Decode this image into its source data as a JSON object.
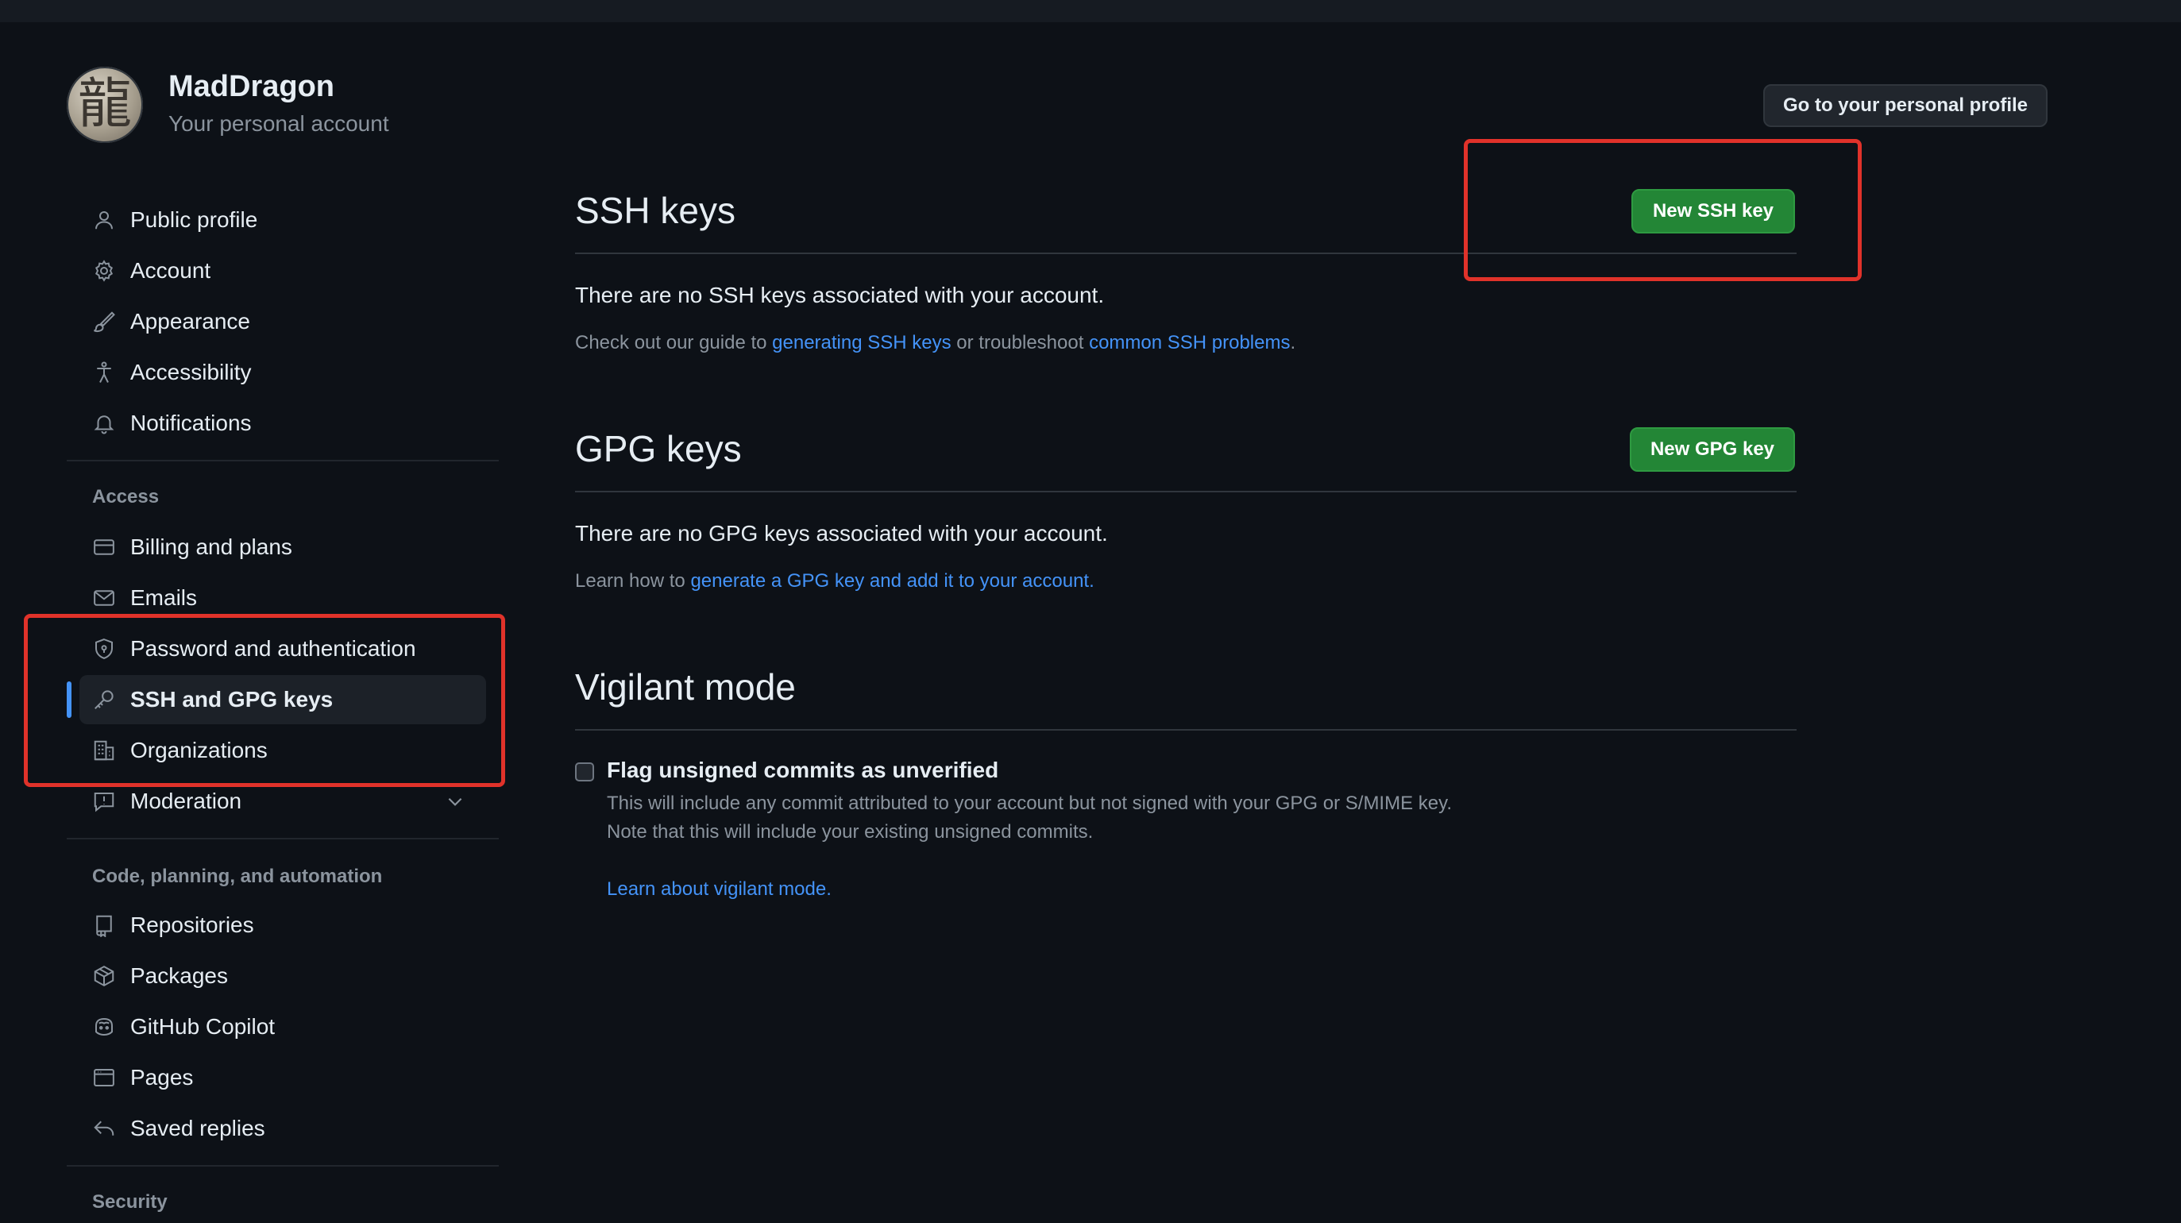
{
  "account": {
    "username": "MadDragon",
    "subtitle": "Your personal account",
    "avatar_glyph": "龍",
    "profile_button": "Go to your personal profile"
  },
  "sidebar": {
    "top_items": [
      {
        "label": "Public profile",
        "icon": "person-icon"
      },
      {
        "label": "Account",
        "icon": "gear-icon"
      },
      {
        "label": "Appearance",
        "icon": "paintbrush-icon"
      },
      {
        "label": "Accessibility",
        "icon": "accessibility-icon"
      },
      {
        "label": "Notifications",
        "icon": "bell-icon"
      }
    ],
    "access_heading": "Access",
    "access_items": [
      {
        "label": "Billing and plans",
        "icon": "credit-card-icon"
      },
      {
        "label": "Emails",
        "icon": "mail-icon"
      },
      {
        "label": "Password and authentication",
        "icon": "shield-lock-icon"
      },
      {
        "label": "SSH and GPG keys",
        "icon": "key-icon",
        "active": true
      },
      {
        "label": "Organizations",
        "icon": "organization-icon"
      },
      {
        "label": "Moderation",
        "icon": "report-icon"
      }
    ],
    "code_heading": "Code, planning, and automation",
    "code_items": [
      {
        "label": "Repositories",
        "icon": "repo-icon"
      },
      {
        "label": "Packages",
        "icon": "package-icon"
      },
      {
        "label": "GitHub Copilot",
        "icon": "copilot-icon"
      },
      {
        "label": "Pages",
        "icon": "browser-icon"
      },
      {
        "label": "Saved replies",
        "icon": "reply-icon"
      }
    ],
    "security_heading": "Security"
  },
  "ssh": {
    "title": "SSH keys",
    "button": "New SSH key",
    "empty_text": "There are no SSH keys associated with your account.",
    "guide_prefix": "Check out our guide to ",
    "guide_link1": "generating SSH keys",
    "guide_mid": " or troubleshoot ",
    "guide_link2": "common SSH problems",
    "guide_suffix": "."
  },
  "gpg": {
    "title": "GPG keys",
    "button": "New GPG key",
    "empty_text": "There are no GPG keys associated with your account.",
    "learn_prefix": "Learn how to ",
    "learn_link": "generate a GPG key and add it to your account",
    "learn_suffix": "."
  },
  "vigilant": {
    "title": "Vigilant mode",
    "checkbox_label": "Flag unsigned commits as unverified",
    "checked": false,
    "note_line1": "This will include any commit attributed to your account but not signed with your GPG or S/MIME key.",
    "note_line2": "Note that this will include your existing unsigned commits.",
    "learn_link": "Learn about vigilant mode."
  },
  "colors": {
    "background": "#0d1117",
    "accent_link": "#4493f8",
    "primary_button": "#238636",
    "annotation": "#e0322a"
  }
}
